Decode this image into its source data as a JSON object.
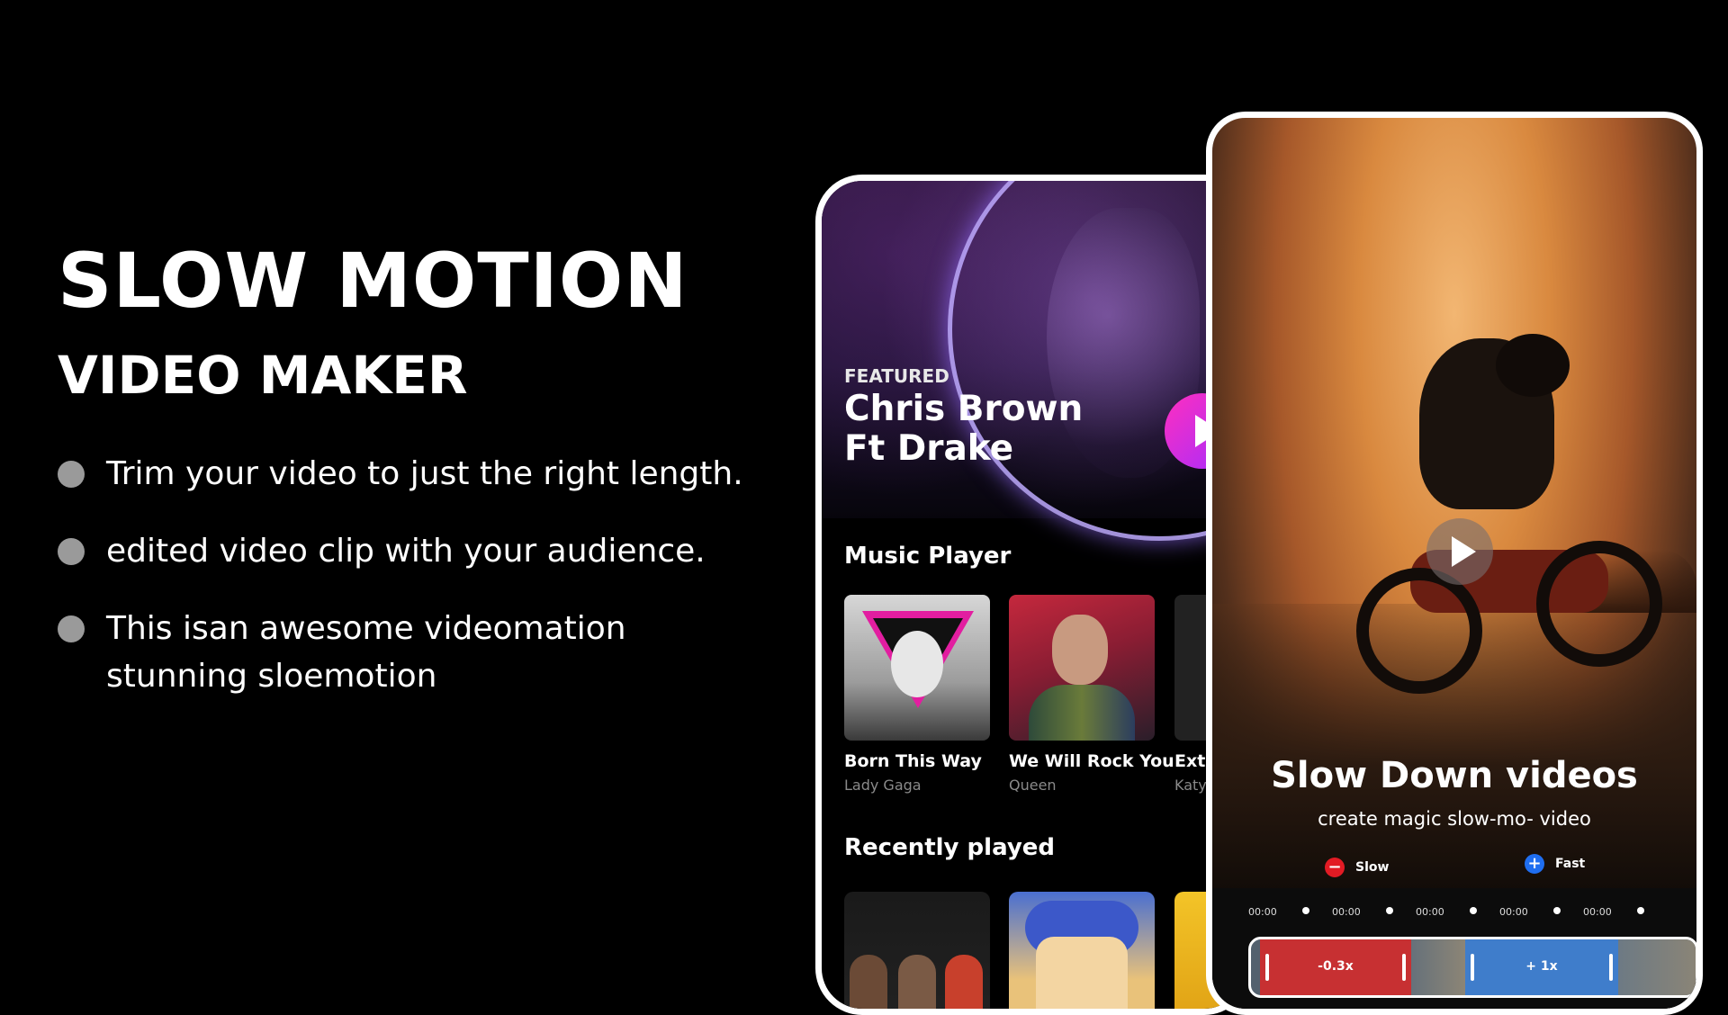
{
  "hero": {
    "title": "SLOW MOTION",
    "subtitle": "VIDEO MAKER",
    "bullets": [
      "Trim your video to just the right length.",
      "edited video clip with your audience.",
      "This isan awesome videomation\nstunning sloemotion"
    ]
  },
  "music_app": {
    "featured_label": "FEATURED",
    "featured_title": "Chris Brown\nFt Drake",
    "section_music": "Music Player",
    "albums": [
      {
        "name": "Born This Way",
        "artist": "Lady Gaga"
      },
      {
        "name": "We Will Rock You",
        "artist": "Queen"
      },
      {
        "name": "Extr",
        "artist": "Katy"
      }
    ],
    "section_recent": "Recently played",
    "accent": "#e62bd0"
  },
  "slowmo_app": {
    "title": "Slow Down videos",
    "subtitle": "create magic slow-mo- video",
    "slow_label": "Slow",
    "fast_label": "Fast",
    "slow_icon": "−",
    "fast_icon": "+",
    "timestamps": [
      "00:00",
      "00:00",
      "00:00",
      "00:00",
      "00:00"
    ],
    "segments": [
      {
        "label": "-0.3x",
        "color": "#dc2828"
      },
      {
        "label": "+ 1x",
        "color": "#3c82dc"
      }
    ]
  }
}
